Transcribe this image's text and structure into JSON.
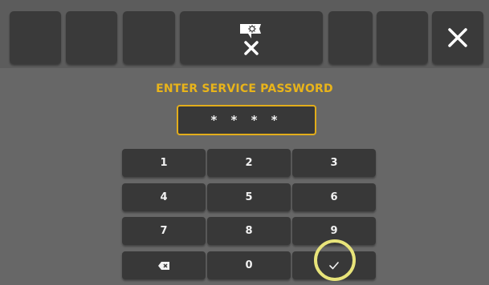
{
  "title": "ENTER SERVICE PASSWORD",
  "password": {
    "masked": "* * * *"
  },
  "keypad": {
    "rows": [
      [
        "1",
        "2",
        "3"
      ],
      [
        "4",
        "5",
        "6"
      ],
      [
        "7",
        "8",
        "9"
      ]
    ],
    "zero": "0",
    "backspace_icon": "backspace-icon",
    "confirm_icon": "checkmark-icon"
  },
  "toolbar": {
    "service_icon": "service-mode-icon",
    "close_icon": "close-icon"
  },
  "colors": {
    "accent": "#e9b41a",
    "highlight": "#e8e47a",
    "background": "#676767",
    "key": "#383838"
  }
}
